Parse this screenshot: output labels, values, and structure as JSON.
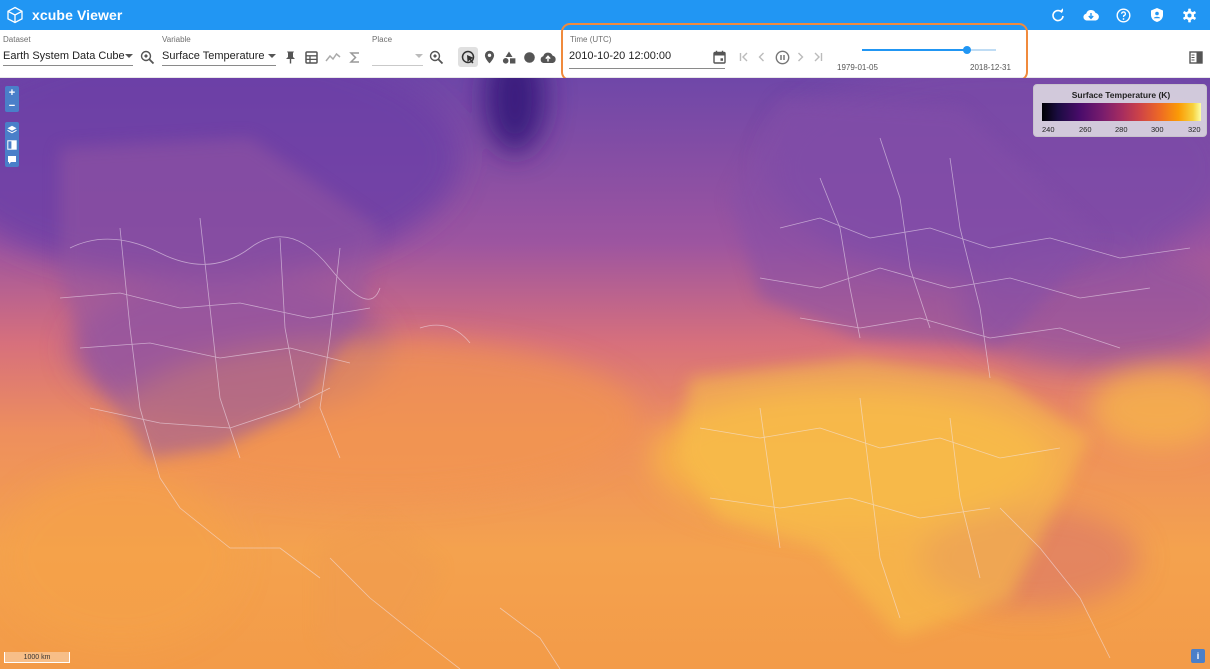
{
  "app": {
    "title": "xcube Viewer",
    "logo_icon": "cube-icon",
    "actions": [
      {
        "name": "refresh-button",
        "icon": "refresh-icon"
      },
      {
        "name": "export-button",
        "icon": "cloud-download-icon"
      },
      {
        "name": "help-button",
        "icon": "help-icon"
      },
      {
        "name": "login-button",
        "icon": "shield-user-icon"
      },
      {
        "name": "settings-button",
        "icon": "gear-icon"
      }
    ]
  },
  "toolbar": {
    "dataset": {
      "label": "Dataset",
      "value": "Earth System Data Cube"
    },
    "variable": {
      "label": "Variable",
      "value": "Surface Temperature"
    },
    "place": {
      "label": "Place",
      "value": ""
    },
    "time": {
      "label": "Time (UTC)",
      "value": "2010-10-20 12:00:00",
      "range_start": "1979-01-05",
      "range_end": "2018-12-31",
      "slider_position": 0.78
    }
  },
  "map": {
    "legend": {
      "title": "Surface Temperature (K)",
      "ticks": [
        "240",
        "260",
        "280",
        "300",
        "320"
      ]
    },
    "scale_label": "1000 km",
    "zoom_in": "+",
    "zoom_out": "−",
    "info_label": "i"
  },
  "colors": {
    "appbar": "#2196f3",
    "highlight": "#f08a3c",
    "control": "#4a7fc9"
  }
}
